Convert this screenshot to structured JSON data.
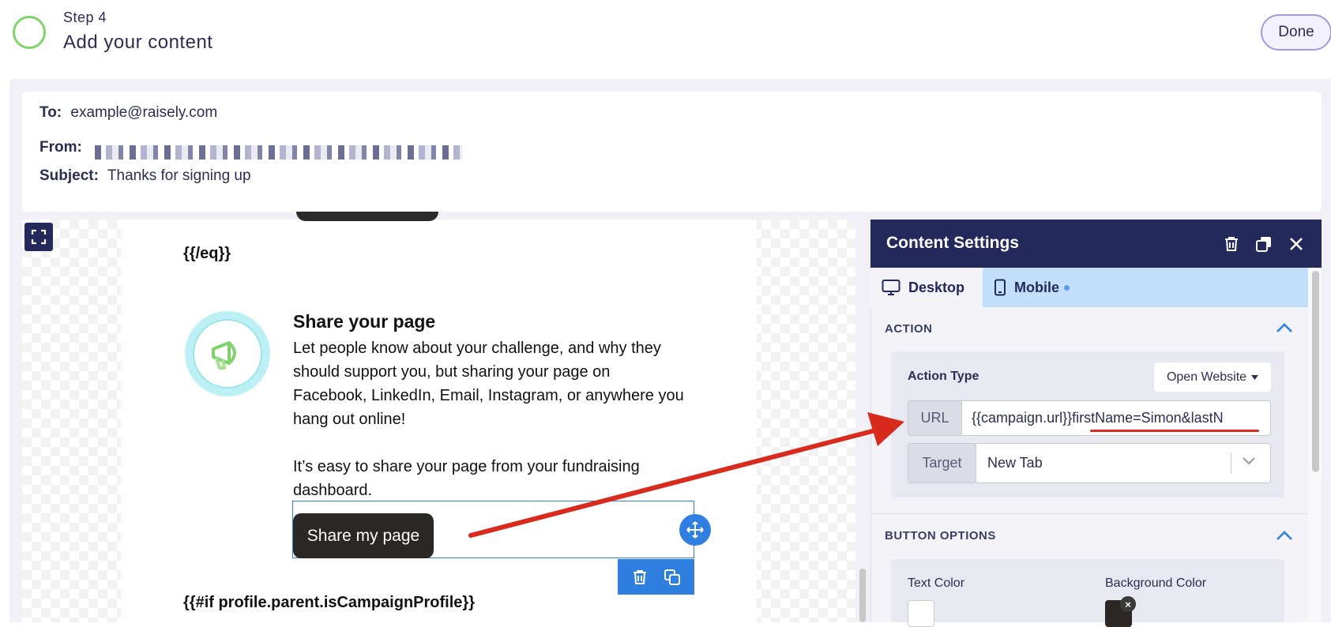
{
  "header": {
    "step_label": "Step 4",
    "step_title": "Add your content",
    "done_label": "Done"
  },
  "meta": {
    "to_label": "To:",
    "to_value": "example@raisely.com",
    "from_label": "From:",
    "subject_label": "Subject:",
    "subject_value": "Thanks for signing up"
  },
  "email": {
    "eq_close": "{{/eq}}",
    "share_title": "Share your page",
    "share_paragraph": "Let people know about your challenge, and why they should support you, but sharing your page on Facebook, LinkedIn, Email, Instagram, or anywhere you hang out online!",
    "share_paragraph2": "It’s easy to share your page from your fundraising dashboard.",
    "button_label": "Share my page",
    "if_line": "{{#if profile.parent.isCampaignProfile}}"
  },
  "panel": {
    "title": "Content Settings",
    "tabs": [
      {
        "label": "Desktop",
        "icon": "desktop-icon",
        "active": true
      },
      {
        "label": "Mobile",
        "icon": "mobile-icon",
        "active": false
      }
    ],
    "action_section": "ACTION",
    "action_type_label": "Action Type",
    "action_type_value": "Open Website",
    "url_label": "URL",
    "url_value": "{{campaign.url}}firstName=Simon&lastN",
    "target_label": "Target",
    "target_value": "New Tab",
    "button_options_section": "BUTTON OPTIONS",
    "text_color_label": "Text Color",
    "background_color_label": "Background Color",
    "remove_color_glyph": "×"
  },
  "colors": {
    "navy": "#23295b",
    "accent_blue": "#2f7fe0",
    "annotation_red": "#d92a1e",
    "step_green": "#7fd36a",
    "button_bg": "#2a2725",
    "text_color_swatch": "#ffffff",
    "background_color_swatch": "#2a2725"
  }
}
